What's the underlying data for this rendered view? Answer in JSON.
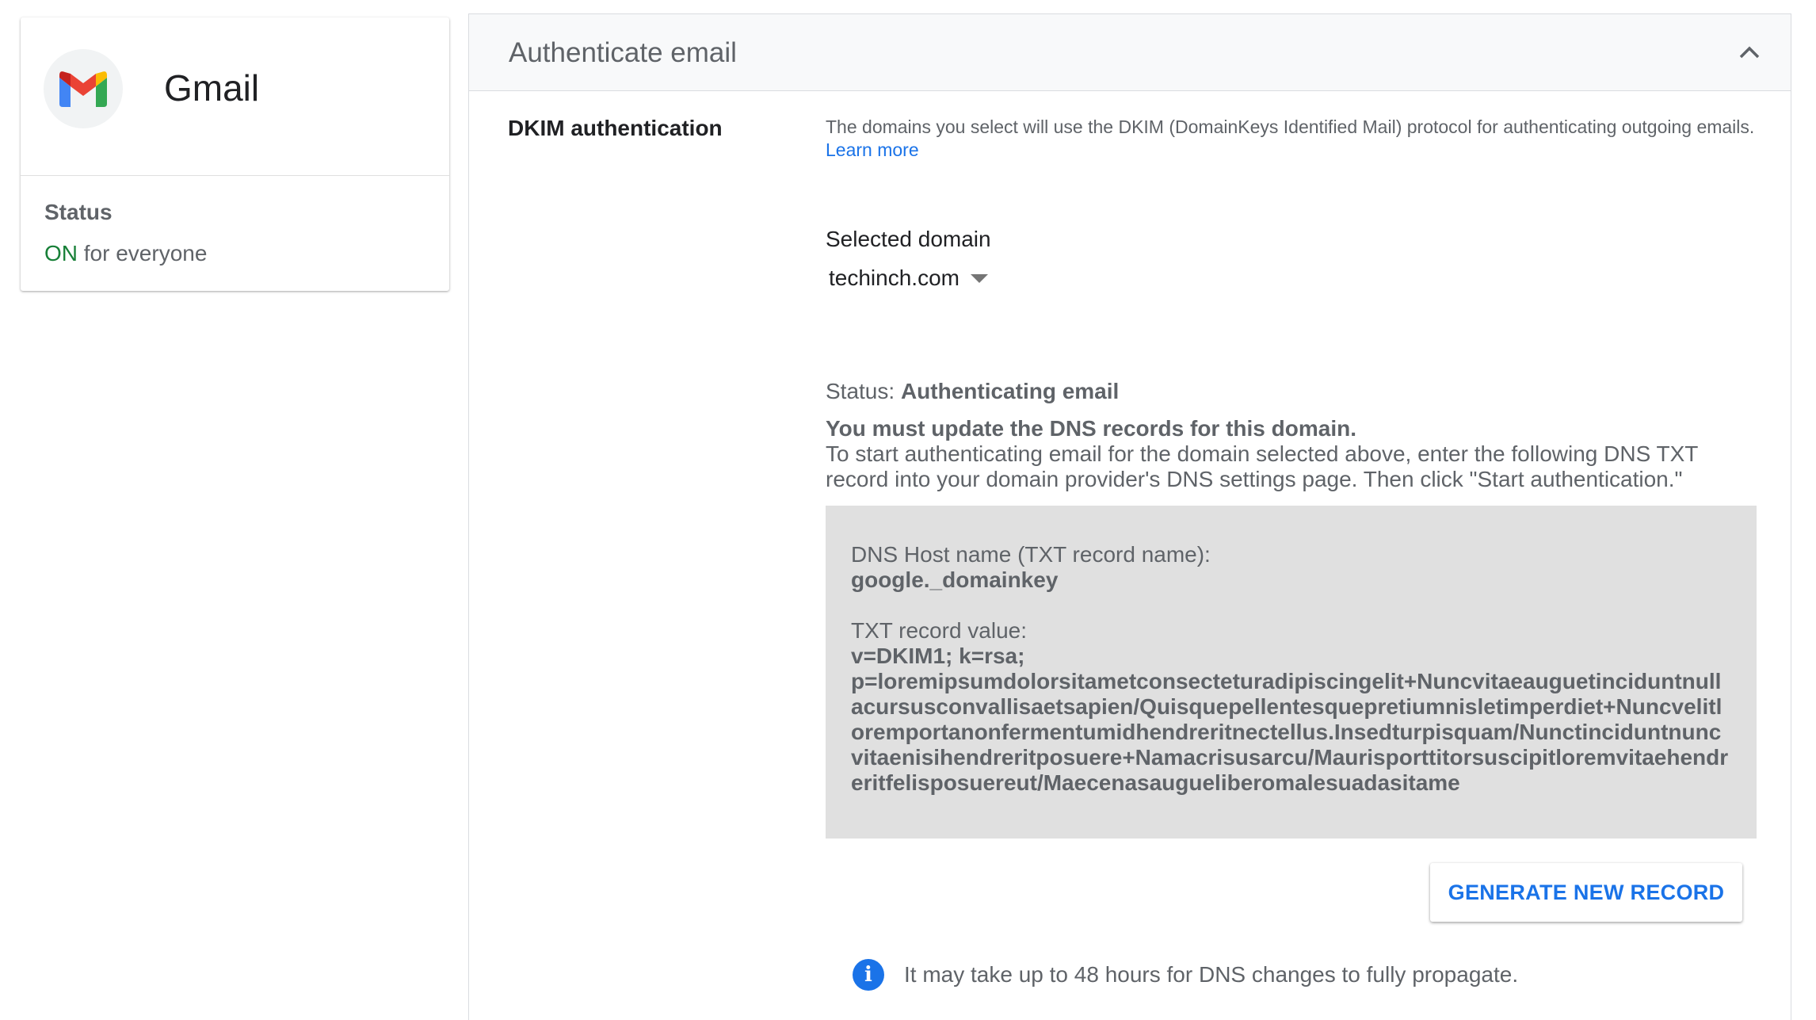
{
  "app": {
    "name": "Gmail",
    "status_label": "Status",
    "status_on": "ON",
    "status_scope": " for everyone"
  },
  "panel": {
    "title": "Authenticate email",
    "section_label": "DKIM authentication",
    "description": "The domains you select will use the DKIM (DomainKeys Identified Mail) protocol for authenticating outgoing emails. ",
    "learn_more": "Learn more",
    "selected_domain_label": "Selected domain",
    "selected_domain": "techinch.com",
    "status_prefix": "Status: ",
    "status_value": "Authenticating email",
    "must_update": "You must update the DNS records for this domain.",
    "instructions": "To start authenticating email for the domain selected above, enter the following DNS TXT record into your domain provider's DNS settings page. Then click \"Start authentication.\"",
    "record": {
      "host_label": "DNS Host name (TXT record name):",
      "host_value": "google._domainkey",
      "txt_label": "TXT record value:",
      "txt_value_line1": "v=DKIM1; k=rsa;",
      "txt_value": "p=loremipsumdolorsitametconsecteturadipiscingelit+Nuncvitaeauguetinciduntnullacursusconvallisaetsapien/Quisquepellentesquepretiumnisletimperdiet+Nuncvelitloremportanonfermentumidhendreritnectellus.Insedturpisquam/Nunctinciduntnuncvitaenisihendreritposuere+Namacrisusarcu/Maurisporttitorsuscipitloremvitaehendreritfelisposuereut/Maecenasaugueliberomalesuadasitame"
    },
    "generate_button": "GENERATE NEW RECORD",
    "info_text": "It may take up to 48 hours for DNS changes to fully propagate."
  },
  "colors": {
    "accent": "#1a73e8",
    "status_on": "#188038",
    "record_bg": "#e0e0e0"
  }
}
